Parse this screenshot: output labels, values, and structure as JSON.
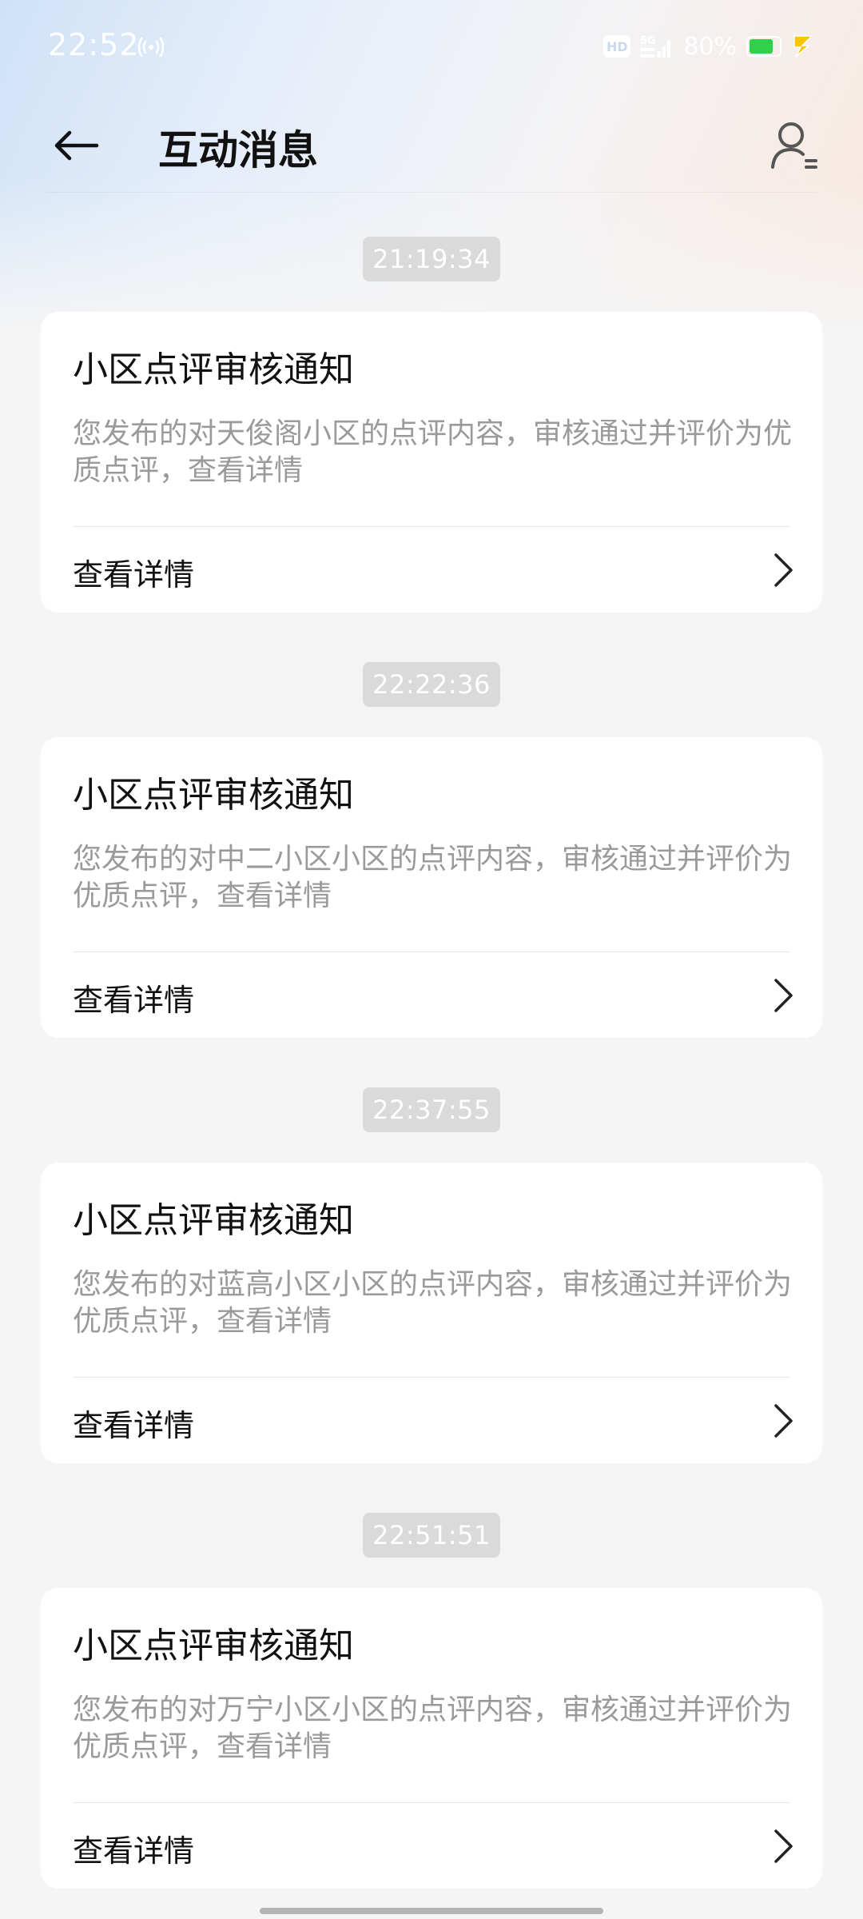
{
  "status_bar": {
    "time": "22:52",
    "hd_label": "HD",
    "network_label": "5G",
    "battery_percent": "80%",
    "battery_level": 0.8
  },
  "header": {
    "title": "互动消息"
  },
  "messages": [
    {
      "time": "21:19:34",
      "title": "小区点评审核通知",
      "body": "您发布的对天俊阁小区的点评内容，审核通过并评价为优质点评，查看详情",
      "link_label": "查看详情"
    },
    {
      "time": "22:22:36",
      "title": "小区点评审核通知",
      "body": "您发布的对中二小区小区的点评内容，审核通过并评价为优质点评，查看详情",
      "link_label": "查看详情"
    },
    {
      "time": "22:37:55",
      "title": "小区点评审核通知",
      "body": "您发布的对蓝高小区小区的点评内容，审核通过并评价为优质点评，查看详情",
      "link_label": "查看详情"
    },
    {
      "time": "22:51:51",
      "title": "小区点评审核通知",
      "body": "您发布的对万宁小区小区的点评内容，审核通过并评价为优质点评，查看详情",
      "link_label": "查看详情"
    }
  ]
}
